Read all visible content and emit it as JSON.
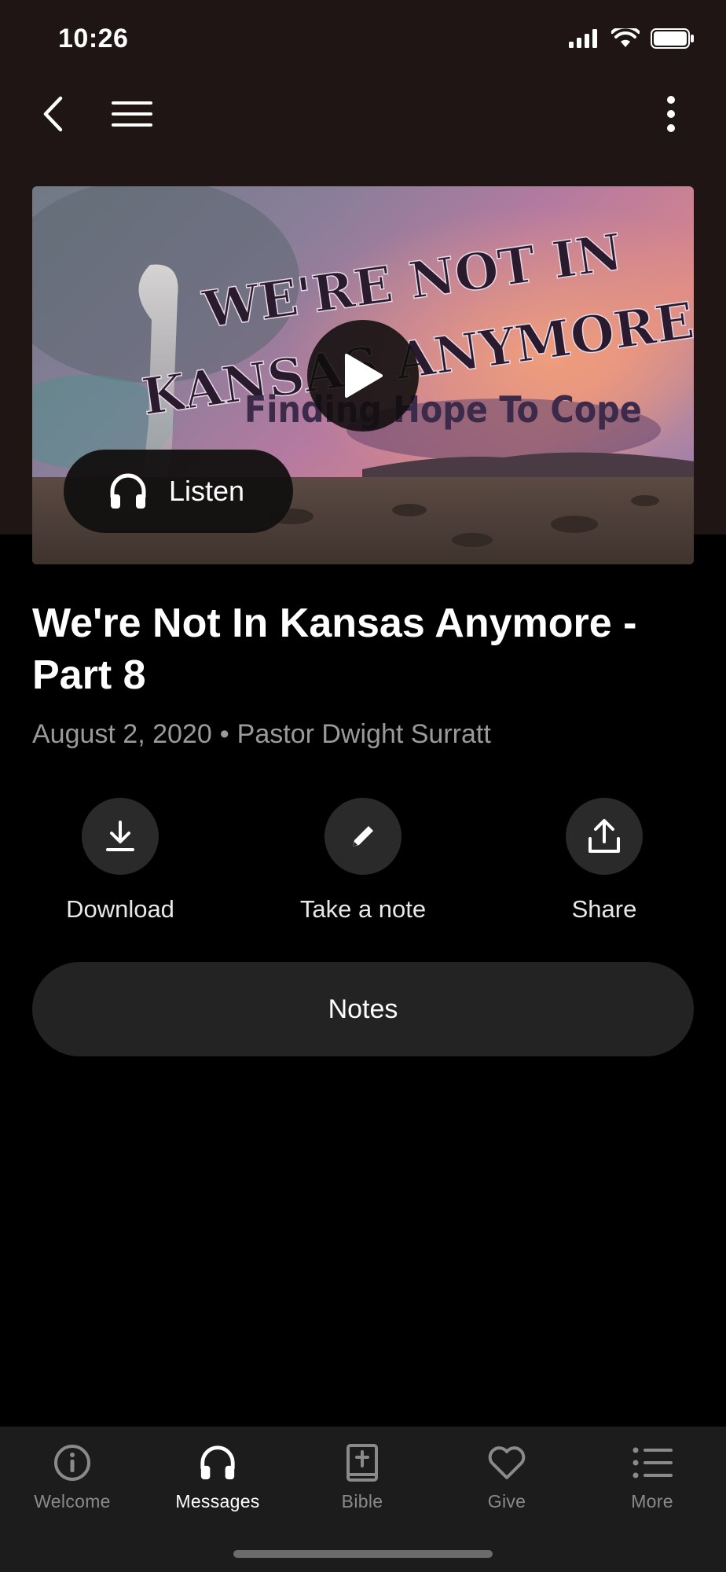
{
  "status": {
    "time": "10:26"
  },
  "nav": {
    "back_icon": "chevron-left-icon",
    "menu_icon": "hamburger-icon",
    "more_icon": "more-vertical-icon"
  },
  "hero": {
    "graphic_line1": "WE'RE NOT IN",
    "graphic_line2": "KANSAS ANYMORE",
    "graphic_line3": "Finding Hope To Cope",
    "play_icon": "play-icon",
    "listen_label": "Listen",
    "listen_icon": "headphones-icon"
  },
  "message": {
    "title": "We're Not In Kansas Anymore - Part 8",
    "date": "August 2, 2020",
    "separator": "•",
    "speaker": "Pastor Dwight Surratt"
  },
  "actions": [
    {
      "label": "Download",
      "icon": "download-icon"
    },
    {
      "label": "Take a note",
      "icon": "pencil-icon"
    },
    {
      "label": "Share",
      "icon": "share-icon"
    }
  ],
  "notes_label": "Notes",
  "tabs": [
    {
      "label": "Welcome",
      "icon": "info-icon",
      "active": false
    },
    {
      "label": "Messages",
      "icon": "headphones-icon",
      "active": true
    },
    {
      "label": "Bible",
      "icon": "bible-icon",
      "active": false
    },
    {
      "label": "Give",
      "icon": "heart-icon",
      "active": false
    },
    {
      "label": "More",
      "icon": "list-icon",
      "active": false
    }
  ],
  "colors": {
    "header_bg": "#1e1514",
    "surface": "#232323",
    "tab_bg": "#1c1c1c",
    "muted_text": "#9a9a9a"
  }
}
